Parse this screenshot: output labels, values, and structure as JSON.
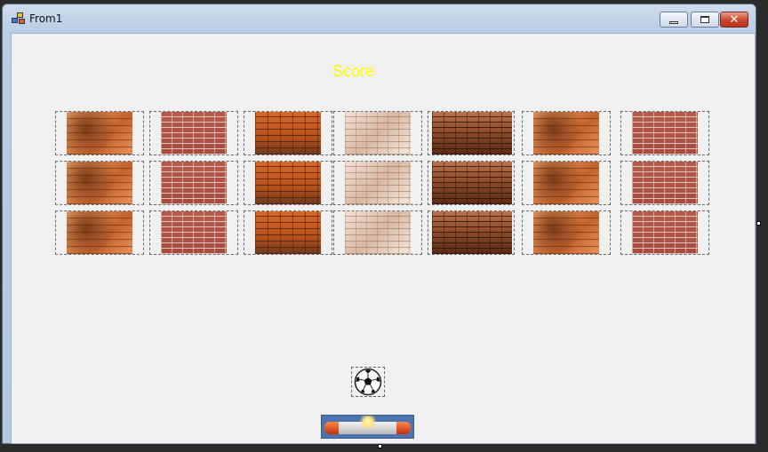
{
  "window": {
    "title": "From1",
    "controls": {
      "minimize": "minimize",
      "maximize": "maximize",
      "close": "✕"
    }
  },
  "game": {
    "score_label": "Score",
    "score_color": "#ffff00",
    "brick_rows": [
      [
        "orange",
        "red",
        "rust",
        "white",
        "dark",
        "orange",
        "red"
      ],
      [
        "orange",
        "red",
        "rust",
        "white",
        "dark",
        "orange",
        "red"
      ],
      [
        "orange",
        "red",
        "rust",
        "white",
        "dark",
        "orange",
        "red"
      ]
    ],
    "ball_icon": "soccer-ball-icon",
    "paddle_icon": "paddle-image"
  }
}
